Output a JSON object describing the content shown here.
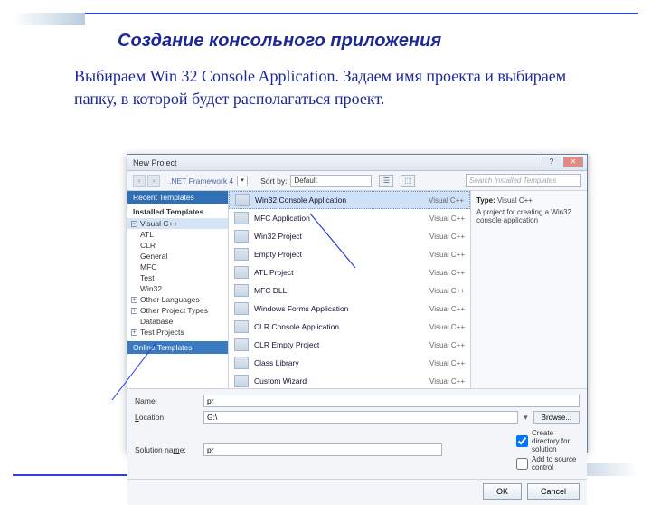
{
  "slide": {
    "title": "Создание консольного приложения",
    "paragraph": "Выбираем Win 32 Console Application.  Задаем имя проекта и выбираем папку, в которой будет располагаться проект."
  },
  "dialog": {
    "title": "New Project",
    "toolbar": {
      "framework": ".NET Framework 4",
      "sortLabel": "Sort by:",
      "sortValue": "Default",
      "searchPlaceholder": "Search Installed Templates"
    },
    "sidebar": {
      "recent": "Recent Templates",
      "installed": "Installed Templates",
      "lang": "Visual C++",
      "items": [
        "ATL",
        "CLR",
        "General",
        "MFC",
        "Test",
        "Win32"
      ],
      "other": "Other Languages",
      "otherpt": "Other Project Types",
      "database": "Database",
      "testproj": "Test Projects",
      "online": "Online Templates"
    },
    "templates": [
      {
        "name": "Win32 Console Application",
        "type": "Visual C++",
        "sel": true
      },
      {
        "name": "MFC Application",
        "type": "Visual C++"
      },
      {
        "name": "Win32 Project",
        "type": "Visual C++"
      },
      {
        "name": "Empty Project",
        "type": "Visual C++"
      },
      {
        "name": "ATL Project",
        "type": "Visual C++"
      },
      {
        "name": "MFC DLL",
        "type": "Visual C++"
      },
      {
        "name": "Windows Forms Application",
        "type": "Visual C++"
      },
      {
        "name": "CLR Console Application",
        "type": "Visual C++"
      },
      {
        "name": "CLR Empty Project",
        "type": "Visual C++"
      },
      {
        "name": "Class Library",
        "type": "Visual C++"
      },
      {
        "name": "Custom Wizard",
        "type": "Visual C++"
      }
    ],
    "detail": {
      "typeLabel": "Type:",
      "typeValue": "Visual C++",
      "desc": "A project for creating a Win32 console application"
    },
    "fields": {
      "nameLabel": "Name:",
      "nameValue": "pr",
      "locationLabel": "Location:",
      "locationValue": "G:\\",
      "solutionLabel": "Solution name:",
      "solutionValue": "pr",
      "browse": "Browse...",
      "chk1": "Create directory for solution",
      "chk2": "Add to source control"
    },
    "buttons": {
      "ok": "OK",
      "cancel": "Cancel"
    }
  }
}
